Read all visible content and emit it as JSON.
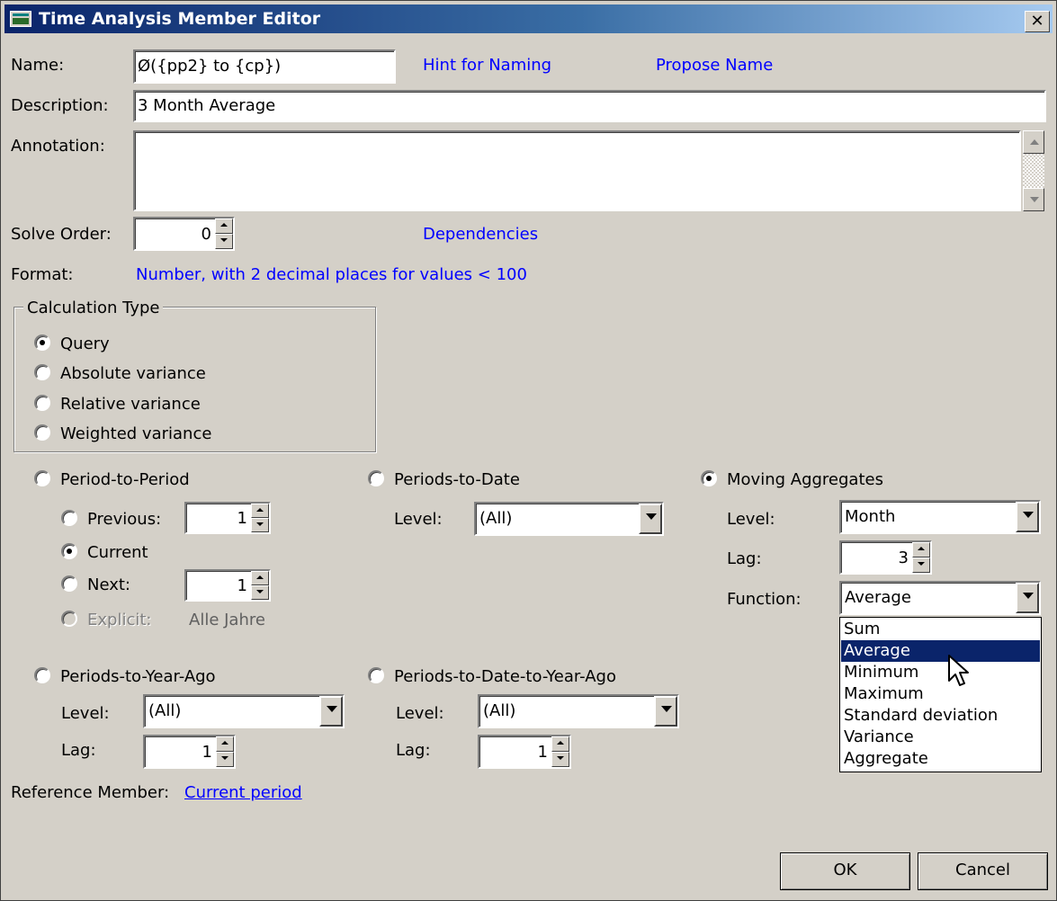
{
  "window": {
    "title": "Time Analysis Member Editor",
    "close_glyph": "✕"
  },
  "form": {
    "name_label": "Name:",
    "name_value": "Ø({pp2} to {cp})",
    "hint_link": "Hint for Naming",
    "propose_link": "Propose Name",
    "description_label": "Description:",
    "description_value": "3 Month Average",
    "annotation_label": "Annotation:",
    "annotation_value": "",
    "solve_order_label": "Solve Order:",
    "solve_order_value": "0",
    "dependencies_link": "Dependencies",
    "format_label": "Format:",
    "format_link": "Number, with 2 decimal places for  values < 100"
  },
  "calc_type": {
    "title": "Calculation Type",
    "options": [
      "Query",
      "Absolute variance",
      "Relative variance",
      "Weighted variance"
    ],
    "selected": "Query"
  },
  "period_to_period": {
    "label": "Period-to-Period",
    "previous_label": "Previous:",
    "previous_value": "1",
    "current_label": "Current",
    "next_label": "Next:",
    "next_value": "1",
    "explicit_label": "Explicit:",
    "explicit_value": "Alle Jahre"
  },
  "periods_to_date": {
    "label": "Periods-to-Date",
    "level_label": "Level:",
    "level_value": "(All)"
  },
  "moving_aggregates": {
    "label": "Moving Aggregates",
    "level_label": "Level:",
    "level_value": "Month",
    "lag_label": "Lag:",
    "lag_value": "3",
    "function_label": "Function:",
    "function_value": "Average",
    "function_options": [
      "Sum",
      "Average",
      "Minimum",
      "Maximum",
      "Standard deviation",
      "Variance",
      "Aggregate"
    ],
    "function_highlighted": "Average"
  },
  "periods_to_year_ago": {
    "label": "Periods-to-Year-Ago",
    "level_label": "Level:",
    "level_value": "(All)",
    "lag_label": "Lag:",
    "lag_value": "1"
  },
  "periods_to_date_to_year_ago": {
    "label": "Periods-to-Date-to-Year-Ago",
    "level_label": "Level:",
    "level_value": "(All)",
    "lag_label": "Lag:",
    "lag_value": "1"
  },
  "reference": {
    "label": "Reference Member:",
    "link": "Current period"
  },
  "buttons": {
    "ok": "OK",
    "cancel": "Cancel"
  }
}
